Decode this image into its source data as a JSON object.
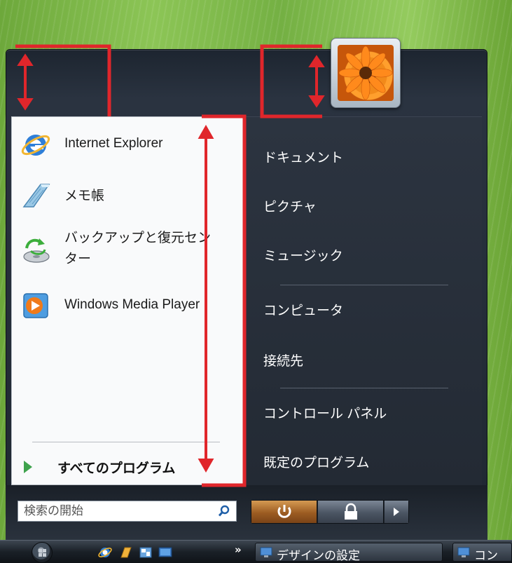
{
  "left_pane": {
    "apps": [
      {
        "label": "Internet Explorer",
        "icon": "internet-explorer-icon"
      },
      {
        "label": "メモ帳",
        "icon": "notepad-icon"
      },
      {
        "label": "バックアップと復元センター",
        "label_line1": "バックアップと復元セン",
        "label_line2": "ター",
        "icon": "backup-restore-icon"
      },
      {
        "label": "Windows Media Player",
        "icon": "media-player-icon"
      }
    ],
    "all_programs": "すべてのプログラム"
  },
  "right_pane": {
    "items": [
      "ドキュメント",
      "ピクチャ",
      "ミュージック",
      "コンピュータ",
      "接続先",
      "コントロール パネル",
      "既定のプログラム"
    ]
  },
  "search": {
    "placeholder": "検索の開始"
  },
  "taskbar": {
    "chevron": "»",
    "buttons": [
      {
        "label": "デザインの設定"
      },
      {
        "label": "コン"
      }
    ]
  },
  "colors": {
    "annotation": "#e0262b",
    "menu_dark": "#1f2731",
    "left_pane_bg": "#f9fafb",
    "right_text": "#ffffff"
  }
}
